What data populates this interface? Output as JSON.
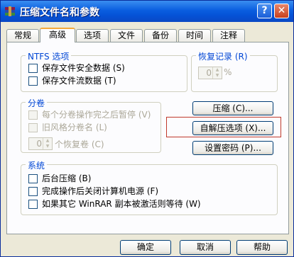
{
  "window": {
    "title": "压缩文件名和参数"
  },
  "titlebar": {
    "help_label": "?",
    "close_label": "✕"
  },
  "tabs": [
    {
      "label": "常规"
    },
    {
      "label": "高级"
    },
    {
      "label": "选项"
    },
    {
      "label": "文件"
    },
    {
      "label": "备份"
    },
    {
      "label": "时间"
    },
    {
      "label": "注释"
    }
  ],
  "ntfs": {
    "title": "NTFS 选项",
    "items": [
      {
        "label": "保存文件安全数据 (S)",
        "checked": false
      },
      {
        "label": "保存文件流数据 (T)",
        "checked": false
      }
    ]
  },
  "recovery": {
    "title": "恢复记录 (R)",
    "value": "0",
    "unit": "%"
  },
  "volumes": {
    "title": "分卷",
    "items": [
      {
        "label": "每个分卷操作完之后暂停 (V)",
        "checked": false
      },
      {
        "label": "旧风格分卷名 (L)",
        "checked": false
      }
    ],
    "spin_value": "0",
    "spin_label": "个恢复卷 (C)"
  },
  "buttons": {
    "compress": "压缩 (C)...",
    "sfx_options": "自解压选项 (X)...",
    "set_password": "设置密码 (P)..."
  },
  "system": {
    "title": "系统",
    "items": [
      {
        "label": "后台压缩 (B)",
        "checked": false
      },
      {
        "label": "完成操作后关闭计算机电源 (F)",
        "checked": false
      },
      {
        "label": "如果其它 WinRAR 副本被激活则等待 (W)",
        "checked": false
      }
    ]
  },
  "footer": {
    "ok": "确定",
    "cancel": "取消",
    "help": "帮助"
  },
  "colors": {
    "accent": "#0046d5",
    "highlight": "#c0392b",
    "titlebar": "#0a5ee0"
  }
}
